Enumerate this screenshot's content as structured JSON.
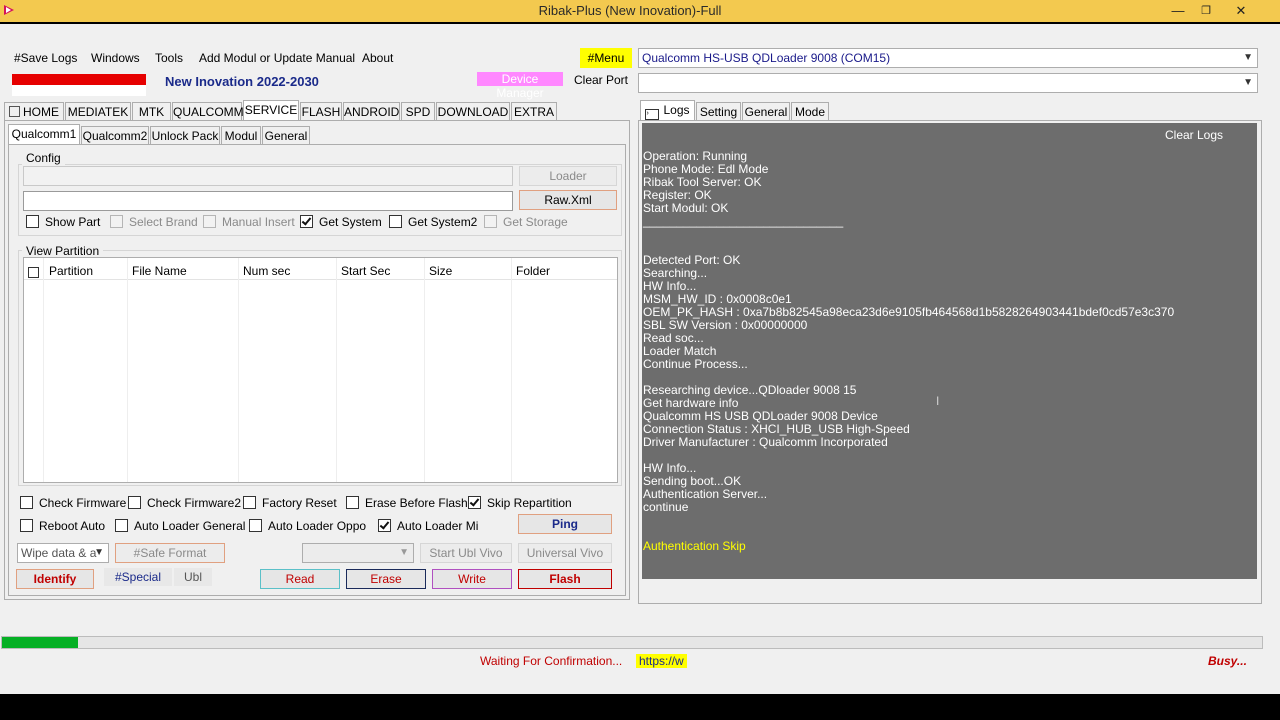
{
  "window": {
    "title": "Ribak-Plus (New Inovation)-Full",
    "controls": {
      "minimize": "—",
      "restore": "❐",
      "close": "✕"
    }
  },
  "menu": {
    "items": [
      "#Save Logs",
      "Windows",
      "Tools",
      "Add Modul or Update Manual",
      "About"
    ],
    "menu_button": "#Menu",
    "device_manager": "Device Manager",
    "clear_port": "Clear Port",
    "tagline": "New Inovation 2022-2030"
  },
  "port": {
    "selected": "Qualcomm HS-USB QDLoader 9008 (COM15)",
    "second": ""
  },
  "main_tabs": [
    "HOME",
    "MEDIATEK",
    "MTK",
    "QUALCOMM",
    "SERVICE",
    "FLASH",
    "ANDROID",
    "SPD",
    "DOWNLOAD",
    "EXTRA"
  ],
  "sub_tabs": [
    "Qualcomm1",
    "Qualcomm2",
    "Unlock Pack",
    "Modul",
    "General"
  ],
  "config": {
    "group_label": "Config",
    "loader_button": "Loader",
    "rawxml_button": "Raw.Xml",
    "loader_path": "",
    "rawxml_path": "",
    "options": [
      {
        "label": "Show Part",
        "checked": false,
        "disabled": false
      },
      {
        "label": "Select Brand",
        "checked": false,
        "disabled": true
      },
      {
        "label": "Manual Insert",
        "checked": false,
        "disabled": true
      },
      {
        "label": "Get System",
        "checked": true,
        "disabled": false
      },
      {
        "label": "Get System2",
        "checked": false,
        "disabled": false
      },
      {
        "label": "Get Storage",
        "checked": false,
        "disabled": true
      }
    ]
  },
  "partition": {
    "group_label": "View Partition",
    "columns": [
      "Partition",
      "File Name",
      "Num sec",
      "Start Sec",
      "Size",
      "Folder"
    ]
  },
  "options_row1": [
    {
      "label": "Check Firmware",
      "checked": false
    },
    {
      "label": "Check Firmware2",
      "checked": false
    },
    {
      "label": "Factory Reset",
      "checked": false
    },
    {
      "label": "Erase Before Flash",
      "checked": false
    },
    {
      "label": "Skip Repartition",
      "checked": true
    }
  ],
  "options_row2": [
    {
      "label": "Reboot Auto",
      "checked": false
    },
    {
      "label": "Auto Loader General",
      "checked": false
    },
    {
      "label": "Auto Loader Oppo",
      "checked": false
    },
    {
      "label": "Auto Loader Mi",
      "checked": true
    }
  ],
  "actions": {
    "ping": "Ping",
    "wipe_select": "Wipe data & a",
    "safe_format": "#Safe Format",
    "vivo_select": "",
    "start_ubl_vivo": "Start Ubl Vivo",
    "universal_vivo": "Universal Vivo",
    "identify": "Identify",
    "special": "#Special",
    "ubl": "Ubl",
    "read": "Read",
    "erase": "Erase",
    "write": "Write",
    "flash": "Flash"
  },
  "right_tabs": [
    "Logs",
    "Setting",
    "General",
    "Mode"
  ],
  "logs": {
    "clear_logs": "Clear Logs",
    "lines": [
      "Operation: Running",
      "Phone Mode: Edl Mode",
      "Ribak Tool Server: OK",
      "Register: OK",
      "Start Modul: OK",
      "______________________________",
      "",
      "",
      "Detected Port: OK",
      "Searching...",
      "HW Info...",
      "MSM_HW_ID : 0x0008c0e1",
      "OEM_PK_HASH : 0xa7b8b82545a98eca23d6e9105fb464568d1b5828264903441bdef0cd57e3c370",
      "SBL SW Version : 0x00000000",
      "Read soc...",
      "Loader Match",
      "Continue Process...",
      "",
      "Researching device...QDloader 9008 15",
      "Get hardware info",
      "Qualcomm HS USB QDLoader 9008 Device",
      "Connection Status : XHCI_HUB_USB High-Speed",
      "Driver Manufacturer : Qualcomm Incorporated",
      "",
      "HW Info...",
      "Sending boot...OK",
      "Authentication Server...",
      "continue"
    ],
    "highlight_line": "Authentication Skip"
  },
  "status": {
    "progress": 0.06,
    "message": "Waiting For Confirmation...",
    "link": "https://w",
    "busy": "Busy..."
  },
  "colors": {
    "titlebar": "#f3c94f",
    "menu_button_bg": "#ffff00",
    "device_manager_bg": "#ff88ff",
    "log_bg": "#6d6d6d",
    "log_highlight": "#ffff00",
    "progress": "#06b025",
    "status_red": "#c00000"
  }
}
